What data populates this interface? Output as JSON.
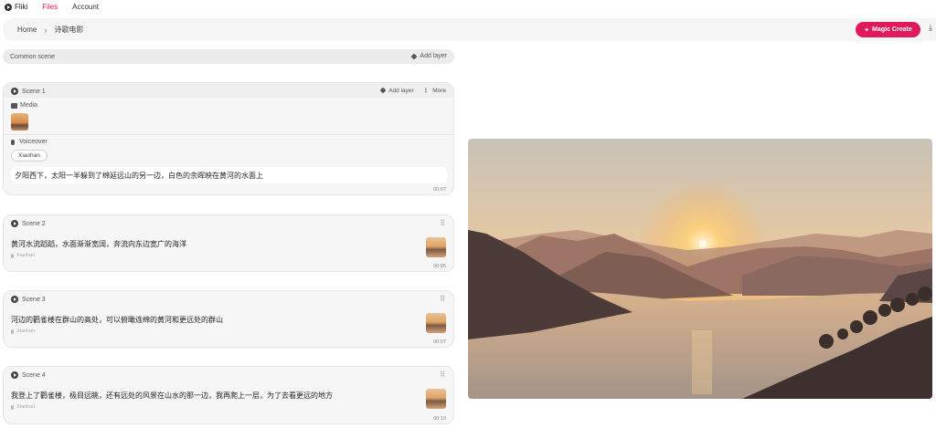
{
  "nav": {
    "brand": "Fliki",
    "items": [
      {
        "label": "Files",
        "active": true
      },
      {
        "label": "Account",
        "active": false
      }
    ]
  },
  "breadcrumb": {
    "home": "Home",
    "separator": "›",
    "current": "诗歌电影"
  },
  "toolbar": {
    "magic_create_label": "Magic Create",
    "download_icon": "download-icon"
  },
  "common_scene": {
    "label": "Common scene",
    "add_layer_label": "Add layer"
  },
  "scene1": {
    "title": "Scene 1",
    "add_layer_label": "Add layer",
    "more_label": "More",
    "media_label": "Media",
    "voiceover_label": "Voiceover",
    "voice_name": "Xiaohan",
    "text": "夕阳西下，太阳一半躲到了绵延远山的另一边，白色的余晖映在黄河的水面上",
    "duration": "00:07"
  },
  "scenes": [
    {
      "title": "Scene 2",
      "text": "黄河水流蹈蹈，水面渐渐宽阔，奔流向东边宽广的海洋",
      "voice": "Xiaohan",
      "duration": "00:05"
    },
    {
      "title": "Scene 3",
      "text": "河边的鹳雀楼在群山的高处，可以俯瞰连绵的黄河和更远处的群山",
      "voice": "Xiaohan",
      "duration": "00:07"
    },
    {
      "title": "Scene 4",
      "text": "我登上了鹳雀楼，极目远眺，还有远处的风景在山水的那一边，我再爬上一层，为了去看更远的地方",
      "voice": "Xiaohan",
      "duration": "00:10"
    }
  ],
  "colors": {
    "accent": "#e0195e",
    "active_nav": "#e2185d"
  }
}
